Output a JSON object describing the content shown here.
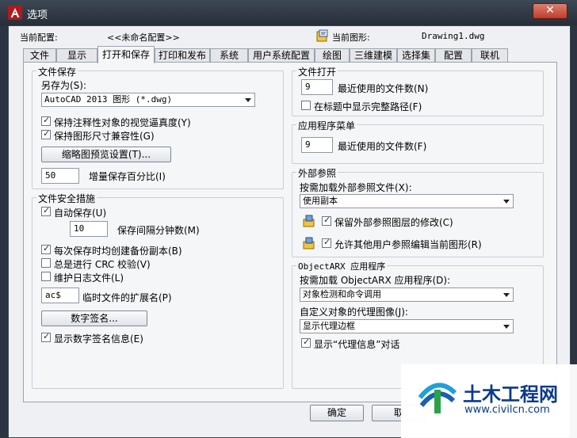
{
  "window": {
    "title": "选项",
    "close_glyph": "✕"
  },
  "profile": {
    "current_profile_label": "当前配置:",
    "current_profile_value": "<<未命名配置>>",
    "current_drawing_label": "当前图形:",
    "current_drawing_value": "Drawing1.dwg"
  },
  "tabs": [
    {
      "label": "文件"
    },
    {
      "label": "显示"
    },
    {
      "label": "打开和保存"
    },
    {
      "label": "打印和发布"
    },
    {
      "label": "系统"
    },
    {
      "label": "用户系统配置"
    },
    {
      "label": "绘图"
    },
    {
      "label": "三维建模"
    },
    {
      "label": "选择集"
    },
    {
      "label": "配置"
    },
    {
      "label": "联机"
    }
  ],
  "active_tab": "打开和保存",
  "file_save": {
    "title": "文件保存",
    "save_as_label": "另存为(S):",
    "save_as_value": "AutoCAD 2013 图形 (*.dwg)",
    "keep_annotative_label": "保持注释性对象的视觉逼真度(Y)",
    "keep_annotative_checked": true,
    "keep_drawing_size_label": "保持图形尺寸兼容性(G)",
    "keep_drawing_size_checked": true,
    "thumbnail_button": "缩略图预览设置(T)...",
    "incremental_value": "50",
    "incremental_label": "增量保存百分比(I)"
  },
  "file_safety": {
    "title": "文件安全措施",
    "autosave_label": "自动保存(U)",
    "autosave_checked": true,
    "minutes_value": "10",
    "minutes_label": "保存间隔分钟数(M)",
    "backup_label": "每次保存时均创建备份副本(B)",
    "backup_checked": true,
    "crc_label": "总是进行 CRC 校验(V)",
    "crc_checked": false,
    "log_label": "维护日志文件(L)",
    "log_checked": false,
    "temp_ext_value": "ac$",
    "temp_ext_label": "临时文件的扩展名(P)",
    "digital_sig_button": "数字签名...",
    "show_sig_label": "显示数字签名信息(E)",
    "show_sig_checked": true
  },
  "file_open": {
    "title": "文件打开",
    "recent_value": "9",
    "recent_label": "最近使用的文件数(N)",
    "full_path_label": "在标题中显示完整路径(F)",
    "full_path_checked": false
  },
  "app_menu": {
    "title": "应用程序菜单",
    "recent_value": "9",
    "recent_label": "最近使用的文件数(F)"
  },
  "xref": {
    "title": "外部参照",
    "demand_load_label": "按需加载外部参照文件(X):",
    "demand_load_value": "使用副本",
    "retain_changes_label": "保留外部参照图层的修改(C)",
    "retain_changes_checked": true,
    "allow_edit_label": "允许其他用户参照编辑当前图形(R)",
    "allow_edit_checked": true
  },
  "objectarx": {
    "title": "ObjectARX 应用程序",
    "demand_load_label": "按需加载 ObjectARX 应用程序(D):",
    "demand_load_value": "对象检测和命令调用",
    "proxy_images_label": "自定义对象的代理图像(J):",
    "proxy_images_value": "显示代理边框",
    "show_proxy_label": "显示“代理信息”对话",
    "show_proxy_checked": true
  },
  "footer": {
    "ok_button": "确定",
    "cancel_button": "取"
  },
  "watermark": {
    "brand_text": "土木工程网",
    "url_text": "www.civilcn.com"
  },
  "colors": {
    "titlebar": "#2b3440",
    "dialog_bg": "#eef0f3",
    "close_button": "#c13d2a",
    "watermark_brand": "#0a3a8a"
  }
}
